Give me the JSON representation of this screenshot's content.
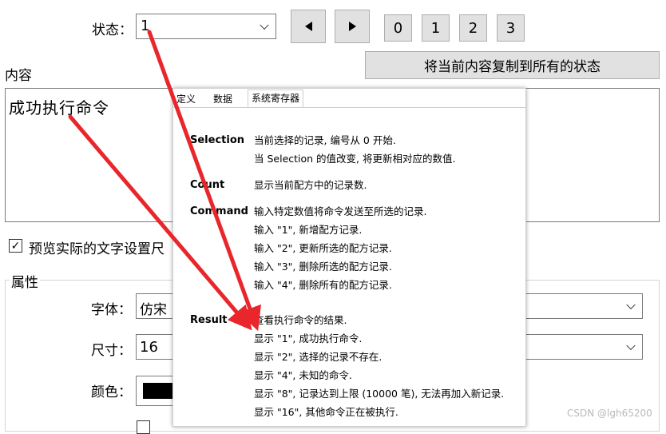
{
  "status": {
    "label": "状态：",
    "value": "1",
    "number_buttons": [
      "0",
      "1",
      "2",
      "3"
    ]
  },
  "copy_button_label": "将当前内容复制到所有的状态",
  "content": {
    "label": "内容",
    "text": "成功执行命令"
  },
  "preview_checkbox": {
    "label": "预览实际的文字设置尺",
    "checked": true
  },
  "properties": {
    "title": "属性",
    "font_label": "字体：",
    "font_value": "仿宋",
    "size_label": "尺寸：",
    "size_value": "16",
    "color_label": "颜色：",
    "color_value": "#000000"
  },
  "help": {
    "tabs": [
      "定义",
      "数据",
      "系统寄存器"
    ],
    "sections": [
      {
        "term": "Selection",
        "lines": [
          "当前选择的记录, 编号从 0 开始.",
          "当 Selection 的值改变, 将更新相对应的数值."
        ]
      },
      {
        "term": "Count",
        "lines": [
          "显示当前配方中的记录数."
        ]
      },
      {
        "term": "Command",
        "lines": [
          "输入特定数值将命令发送至所选的记录.",
          "输入 \"1\", 新增配方记录.",
          "输入 \"2\", 更新所选的配方记录.",
          "输入 \"3\", 删除所选的配方记录.",
          "输入 \"4\", 删除所有的配方记录."
        ]
      },
      {
        "term": "Result",
        "lines": [
          "查看执行命令的结果.",
          "显示 \"1\", 成功执行命令.",
          "显示 \"2\", 选择的记录不存在.",
          "显示 \"4\", 未知的命令.",
          "显示 \"8\", 记录达到上限 (10000 笔), 无法再加入新记录.",
          "显示 \"16\", 其他命令正在被执行."
        ]
      }
    ]
  },
  "watermark": "CSDN @lgh65200",
  "colors": {
    "arrow": "#e8262b",
    "button_bg": "#e1e1e1"
  }
}
